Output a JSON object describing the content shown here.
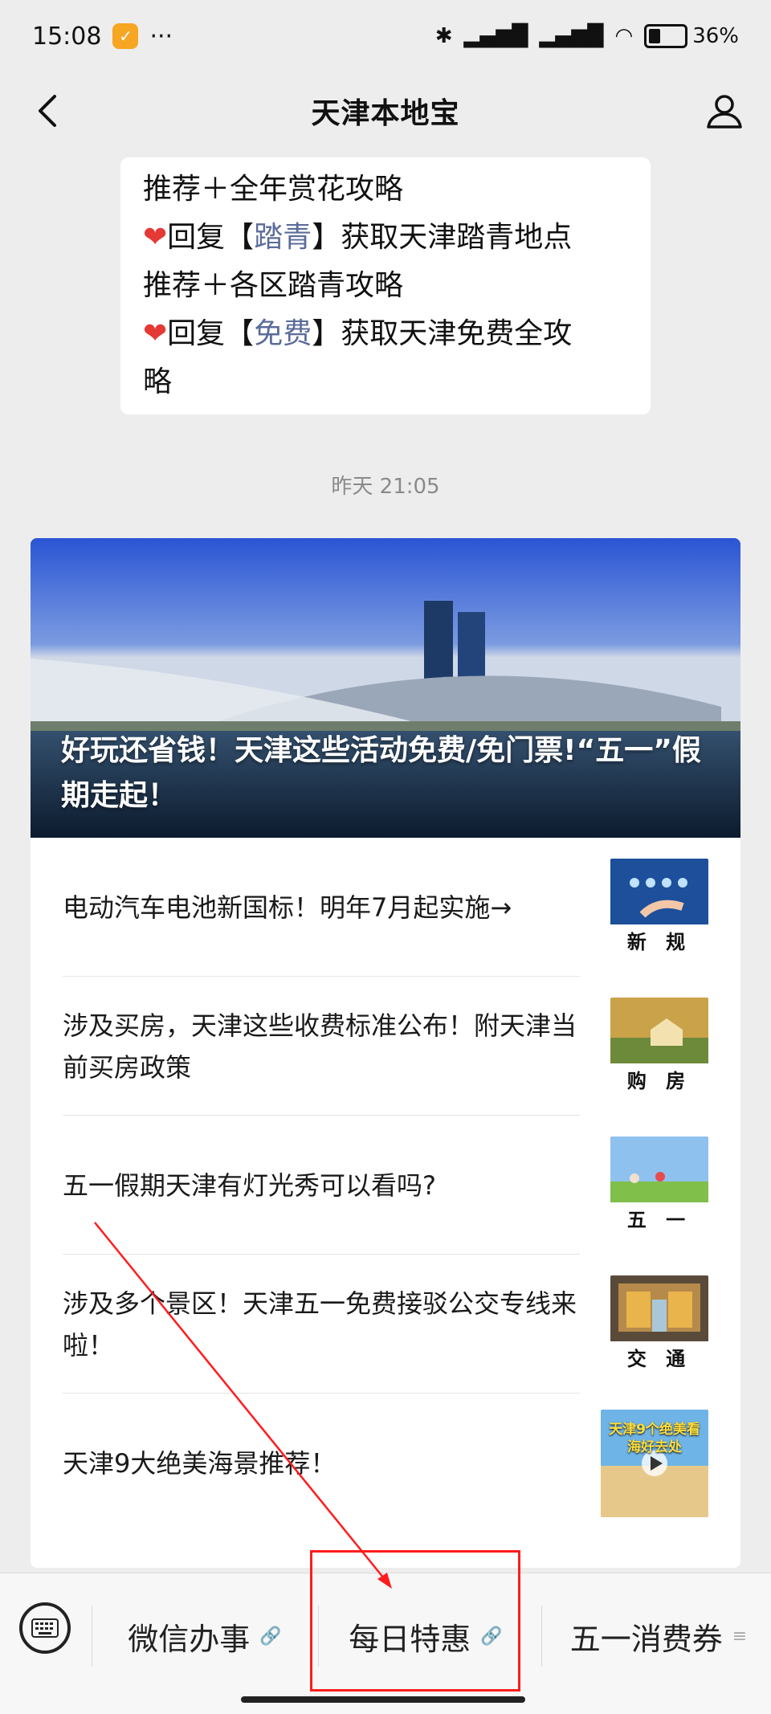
{
  "status_bar": {
    "time": "15:08",
    "battery_percent": "36%"
  },
  "header": {
    "title": "天津本地宝"
  },
  "message_bubble": {
    "line1": "推荐＋全年赏花攻略",
    "line2_pre": "回复【",
    "line2_kw": "踏青",
    "line2_post": "】获取天津踏青地点",
    "line3": "推荐＋各区踏青攻略",
    "line4_pre": "回复【",
    "line4_kw": "免费",
    "line4_post": "】获取天津免费全攻",
    "line5": "略"
  },
  "timestamp": "昨天 21:05",
  "article_card": {
    "hero_title": "好玩还省钱！天津这些活动免费/免门票!“五一”假期走起！",
    "items": [
      {
        "title": "电动汽车电池新国标！明年7月起实施→",
        "thumb_label": "新 规"
      },
      {
        "title": "涉及买房，天津这些收费标准公布！附天津当前买房政策",
        "thumb_label": "购 房"
      },
      {
        "title": "五一假期天津有灯光秀可以看吗?",
        "thumb_label": "五 一"
      },
      {
        "title": "涉及多个景区！天津五一免费接驳公交专线来啦！",
        "thumb_label": "交 通"
      },
      {
        "title": "天津9大绝美海景推荐！",
        "thumb_text": "天津9个绝美看海好去处"
      }
    ]
  },
  "bottom_menu": {
    "item1": "微信办事",
    "item2": "每日特惠",
    "item3": "五一消费券"
  }
}
